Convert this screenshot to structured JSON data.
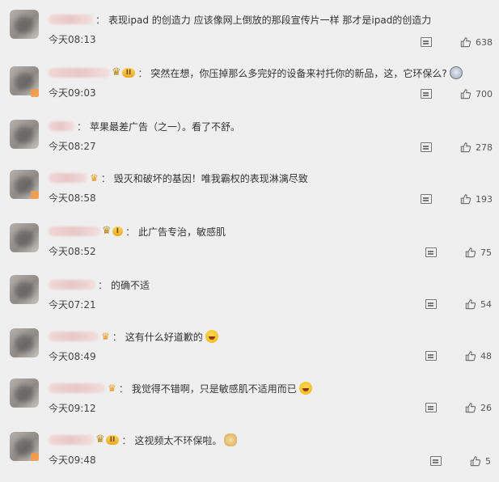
{
  "comments": [
    {
      "time": "今天08:13",
      "text": "表现ipad 的创造力 应该像网上倒放的那段宣传片一样 那才是ipad的创造力",
      "likes": "638",
      "badge": "none",
      "emoji": ""
    },
    {
      "time": "今天09:03",
      "text": "突然在想，你压掉那么多完好的设备来衬托你的新品，这，它环保么?",
      "likes": "700",
      "badge": "vip",
      "vip_level": "II",
      "emoji": "cool"
    },
    {
      "time": "今天08:27",
      "text": "苹果最差广告（之一）。看了不舒。",
      "likes": "278",
      "badge": "none",
      "emoji": ""
    },
    {
      "time": "今天08:58",
      "text": "毁灭和破坏的基因！唯我霸权的表现淋漓尽致",
      "likes": "193",
      "badge": "crown",
      "emoji": ""
    },
    {
      "time": "今天08:52",
      "text": "此广告专治，敏感肌",
      "likes": "75",
      "badge": "vip",
      "vip_level": "I",
      "emoji": ""
    },
    {
      "time": "今天07:21",
      "text": "的确不适",
      "likes": "54",
      "badge": "none",
      "emoji": ""
    },
    {
      "time": "今天08:49",
      "text": "这有什么好道歉的",
      "likes": "48",
      "badge": "crown",
      "emoji": "laugh"
    },
    {
      "time": "今天09:12",
      "text": "我觉得不错啊，只是敏感肌不适用而已",
      "likes": "26",
      "badge": "crown",
      "emoji": "laugh"
    },
    {
      "time": "今天09:48",
      "text": "这视频太不环保啦。",
      "likes": "5",
      "badge": "vip",
      "vip_level": "II",
      "emoji": "doge"
    }
  ],
  "icons": {
    "reply": "comment-icon",
    "like": "thumbs-up-icon",
    "vip": "crown-icon"
  }
}
